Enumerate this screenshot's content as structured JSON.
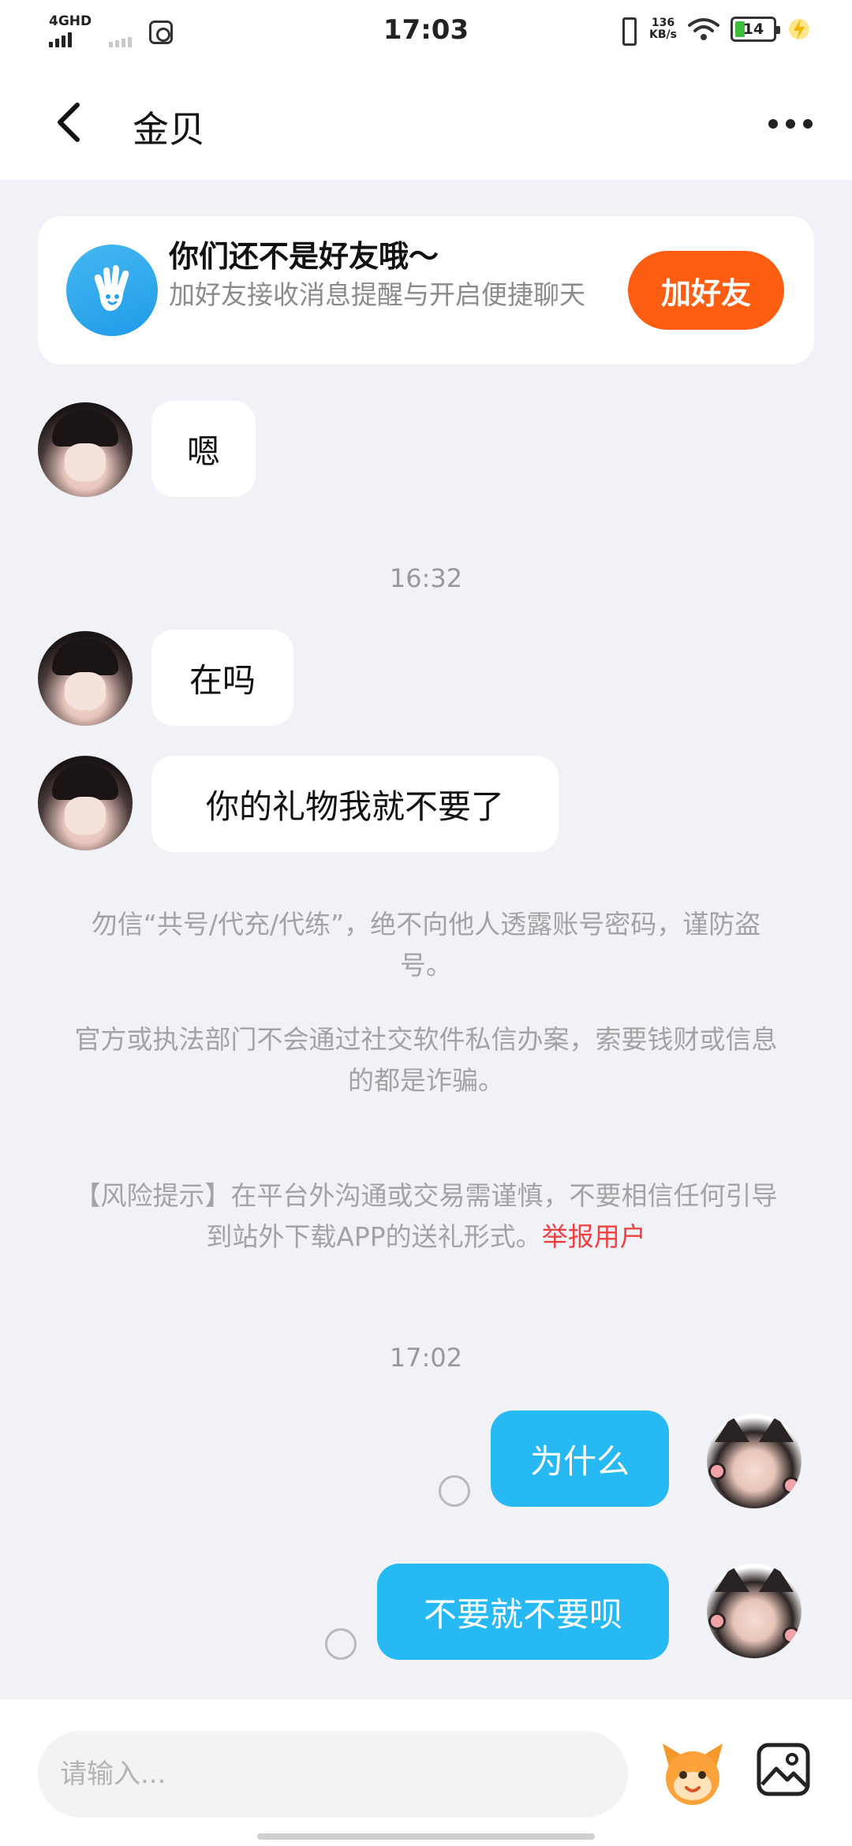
{
  "status_bar": {
    "network_label": "4GHD",
    "time": "17:03",
    "speed_value": "136",
    "speed_unit": "KB/s",
    "battery": "14",
    "icons": [
      "signal-icon",
      "vpn-icon",
      "vibrate-icon",
      "wifi-icon",
      "battery-icon",
      "charging-icon"
    ]
  },
  "header": {
    "title": "金贝",
    "back_icon": "chevron-left-icon",
    "more_icon": "more-dots-icon"
  },
  "friend_banner": {
    "title": "你们还不是好友哦～",
    "subtitle": "加好友接收消息提醒与开启便捷聊天",
    "button_label": "加好友",
    "button_color": "#fe5e12",
    "icon": "hand-icon"
  },
  "messages": [
    {
      "side": "in",
      "text": "嗯"
    },
    {
      "type": "time",
      "text": "16:32"
    },
    {
      "side": "in",
      "text": "在吗"
    },
    {
      "side": "in",
      "text": "你的礼物我就不要了"
    },
    {
      "type": "notice",
      "text": "勿信“共号/代充/代练”，绝不向他人透露账号密码，谨防盗号。"
    },
    {
      "type": "notice",
      "text": "官方或执法部门不会通过社交软件私信办案，索要钱财或信息的都是诈骗。"
    },
    {
      "type": "notice",
      "text": "【风险提示】在平台外沟通或交易需谨慎，不要相信任何引导到站外下载APP的送礼形式。",
      "link": "举报用户"
    },
    {
      "type": "time",
      "text": "17:02"
    },
    {
      "side": "out",
      "text": "为什么"
    },
    {
      "side": "out",
      "text": "不要就不要呗"
    }
  ],
  "input_bar": {
    "placeholder": "请输入...",
    "emoji_icon": "mascot-emoji-icon",
    "image_icon": "image-icon"
  },
  "colors": {
    "out_bubble": "#27b9f4",
    "background": "#f1f2f7",
    "report_link": "#f04141"
  }
}
